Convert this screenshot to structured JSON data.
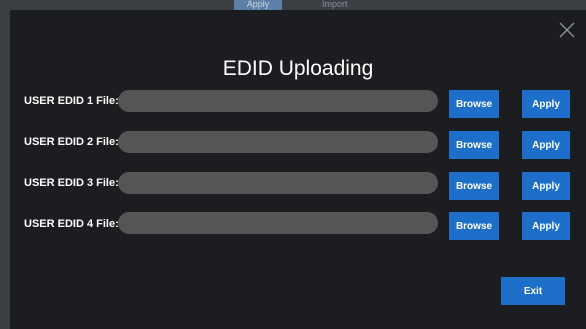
{
  "background": {
    "tabs": [
      {
        "label": "Apply"
      },
      {
        "label": "Import"
      }
    ]
  },
  "dialog": {
    "title": "EDID Uploading",
    "close_icon": "close-icon",
    "rows": [
      {
        "label": "USER EDID 1 File:",
        "value": "",
        "browse_label": "Browse",
        "apply_label": "Apply"
      },
      {
        "label": "USER EDID 2 File:",
        "value": "",
        "browse_label": "Browse",
        "apply_label": "Apply"
      },
      {
        "label": "USER EDID 3 File:",
        "value": "",
        "browse_label": "Browse",
        "apply_label": "Apply"
      },
      {
        "label": "USER EDID 4 File:",
        "value": "",
        "browse_label": "Browse",
        "apply_label": "Apply"
      }
    ],
    "exit_label": "Exit"
  },
  "colors": {
    "dialog_bg": "#1c1d20",
    "button_blue": "#1e6fc9",
    "field_gray": "#555555"
  }
}
